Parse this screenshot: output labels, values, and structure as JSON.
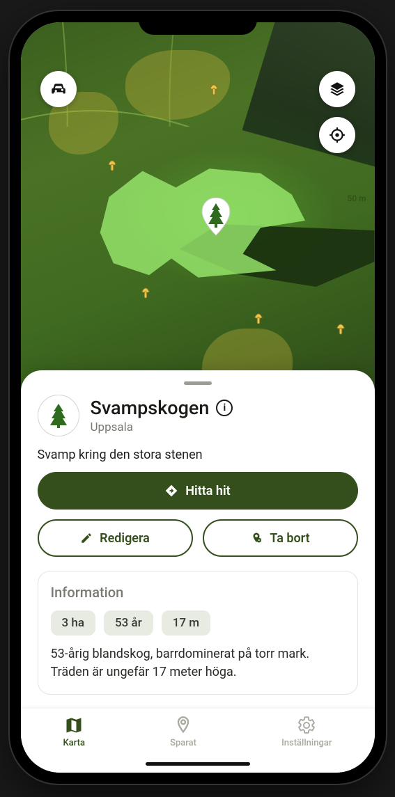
{
  "map": {
    "scale_label": "50 m",
    "icons": {
      "car": "car-icon",
      "layers": "layers-icon",
      "locate": "locate-icon",
      "marker": "tree-marker-icon",
      "mushroom": "mushroom-icon"
    }
  },
  "place": {
    "title": "Svampskogen",
    "subtitle": "Uppsala",
    "note": "Svamp kring den stora stenen"
  },
  "actions": {
    "primary": "Hitta hit",
    "edit": "Redigera",
    "delete": "Ta bort"
  },
  "info": {
    "heading": "Information",
    "chips": [
      "3 ha",
      "53 år",
      "17 m"
    ],
    "body": "53-årig blandskog, barrdominerat på torr mark. Träden är ungefär 17 meter höga."
  },
  "nav": {
    "map": "Karta",
    "saved": "Sparat",
    "settings": "Inställningar"
  }
}
